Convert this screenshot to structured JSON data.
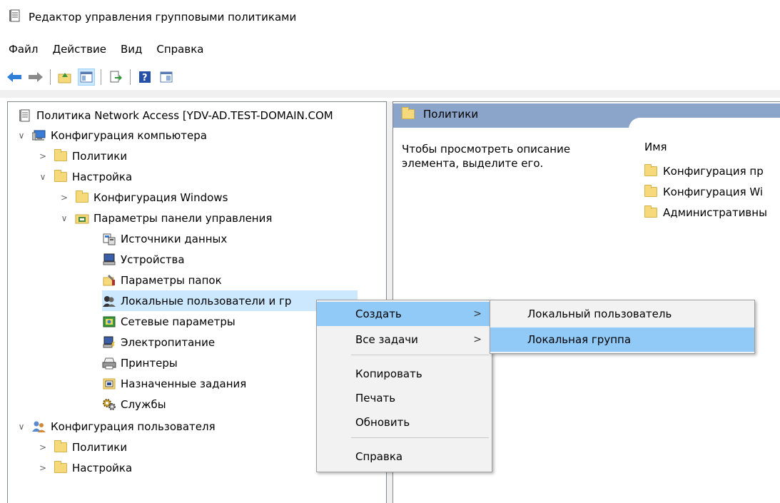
{
  "window": {
    "title": "Редактор управления групповыми политиками"
  },
  "menu": [
    "Файл",
    "Действие",
    "Вид",
    "Справка"
  ],
  "toolbar": [
    "back-arrow-icon",
    "forward-arrow-icon",
    "up-folder-icon",
    "show-tree-icon",
    "export-list-icon",
    "help-icon",
    "properties-icon"
  ],
  "tree": {
    "root": "Политика Network Access [YDV-AD.TEST-DOMAIN.COM",
    "computer_config": "Конфигурация компьютера",
    "policies": "Политики",
    "settings": "Настройка",
    "windows_config": "Конфигурация Windows",
    "control_panel": "Параметры панели управления",
    "items": [
      "Источники данных",
      "Устройства",
      "Параметры папок",
      "Локальные пользователи и гр",
      "Сетевые параметры",
      "Электропитание",
      "Принтеры",
      "Назначенные задания",
      "Службы"
    ],
    "user_config": "Конфигурация пользователя",
    "user_policies": "Политики",
    "user_settings": "Настройка"
  },
  "right": {
    "header": "Политики",
    "description": "Чтобы просмотреть описание элемента, выделите его.",
    "column_name": "Имя",
    "items": [
      "Конфигурация пр",
      "Конфигурация Wi",
      "Административны"
    ]
  },
  "context_menu": {
    "create": "Создать",
    "all_tasks": "Все задачи",
    "copy": "Копировать",
    "print": "Печать",
    "refresh": "Обновить",
    "help": "Справка",
    "submenu_arrow": ">"
  },
  "submenu": {
    "local_user": "Локальный пользователь",
    "local_group": "Локальная группа"
  },
  "colors": {
    "selection": "#cce8ff",
    "menu_highlight": "#91c9f7",
    "pane_header": "#8ba4c9"
  }
}
